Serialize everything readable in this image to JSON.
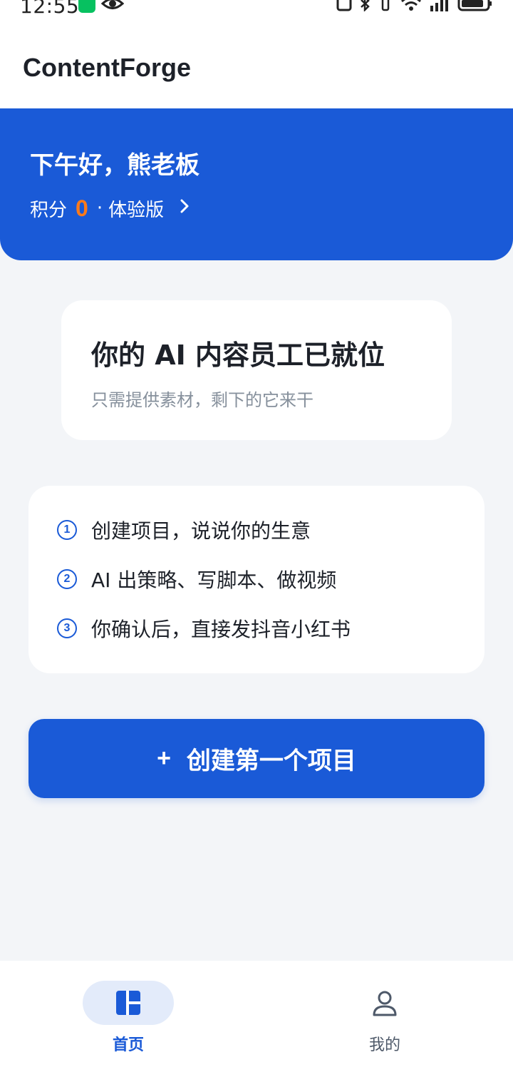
{
  "status_bar": {
    "time": "12:55"
  },
  "header": {
    "app_title": "ContentForge"
  },
  "banner": {
    "greeting": "下午好，熊老板",
    "points_label": "积分",
    "points_value": "0",
    "separator": "·",
    "plan_label": "体验版"
  },
  "hero": {
    "title": "你的 AI 内容员工已就位",
    "subtitle": "只需提供素材，剩下的它来干"
  },
  "steps": [
    {
      "num": "1",
      "text": "创建项目，说说你的生意"
    },
    {
      "num": "2",
      "text": "AI 出策略、写脚本、做视频"
    },
    {
      "num": "3",
      "text": "你确认后，直接发抖音小红书"
    }
  ],
  "create_button": {
    "icon": "+",
    "label": "创建第一个项目"
  },
  "nav": {
    "home": {
      "label": "首页",
      "icon": "dashboard-icon"
    },
    "mine": {
      "label": "我的",
      "icon": "person-icon"
    }
  },
  "colors": {
    "brand_blue": "#1a5ad7",
    "points_orange": "#ff7a1a",
    "background": "#f3f5f8"
  }
}
